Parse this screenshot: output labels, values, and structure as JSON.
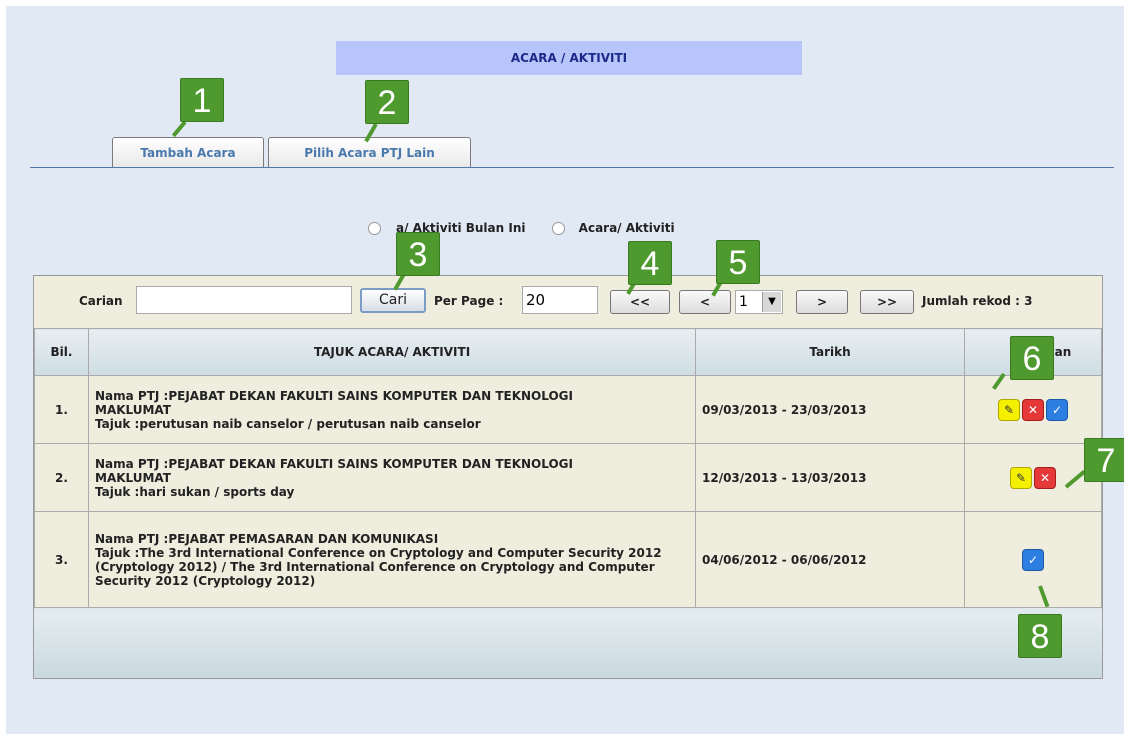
{
  "header": {
    "title": "ACARA / AKTIVITI"
  },
  "tabs": [
    {
      "label": "Tambah Acara"
    },
    {
      "label": "Pilih Acara PTJ Lain"
    }
  ],
  "filters": {
    "option1": "a/ Aktiviti Bulan Ini",
    "option2": "Acara/ Aktiviti"
  },
  "search": {
    "label": "Carian",
    "value": "",
    "button": "Cari",
    "per_page_label": "Per Page :",
    "per_page_value": "20"
  },
  "pagination": {
    "first": "<<",
    "prev": "<",
    "page": "1",
    "next": ">",
    "last": ">>",
    "total": "Jumlah rekod : 3"
  },
  "table": {
    "headers": [
      "Bil.",
      "TAJUK ACARA/ AKTIVITI",
      "Tarikh",
      "an"
    ],
    "rows": [
      {
        "no": "1.",
        "ptj": "Nama PTJ :PEJABAT DEKAN FAKULTI SAINS KOMPUTER DAN TEKNOLOGI MAKLUMAT",
        "tajuk": "Tajuk :perutusan naib canselor / perutusan naib canselor",
        "tarikh": "09/03/2013 - 23/03/2013"
      },
      {
        "no": "2.",
        "ptj": "Nama PTJ :PEJABAT DEKAN FAKULTI SAINS KOMPUTER DAN TEKNOLOGI MAKLUMAT",
        "tajuk": "Tajuk :hari sukan / sports day",
        "tarikh": "12/03/2013 - 13/03/2013"
      },
      {
        "no": "3.",
        "ptj": "Nama PTJ :PEJABAT PEMASARAN DAN KOMUNIKASI",
        "tajuk": "Tajuk :The 3rd International Conference on Cryptology and Computer Security 2012 (Cryptology 2012) / The 3rd International Conference on Cryptology and Computer Security 2012 (Cryptology 2012)",
        "tarikh": "04/06/2012 - 06/06/2012"
      }
    ]
  },
  "icons": {
    "edit": "wrench-icon",
    "delete": "delete-x-icon",
    "approve": "check-icon"
  },
  "callouts": [
    "1",
    "2",
    "3",
    "4",
    "5",
    "6",
    "7",
    "8"
  ],
  "colors": {
    "callout": "#4f9a2f",
    "header_bg": "#b7c5fb",
    "panel_bg": "#e1e9f4"
  }
}
